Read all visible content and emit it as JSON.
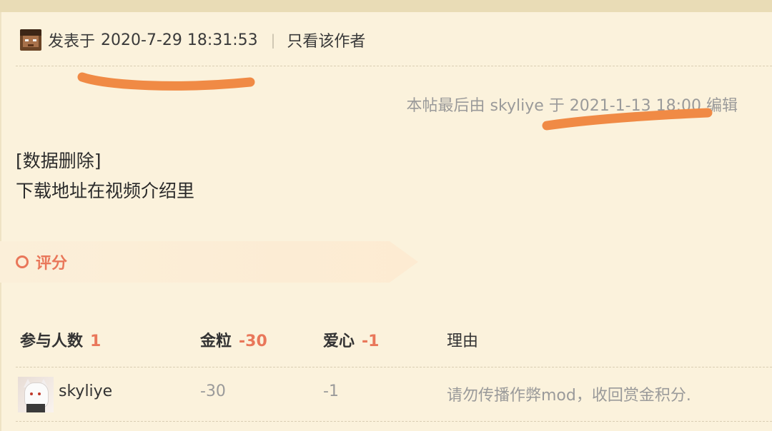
{
  "post": {
    "posted_prefix": "发表于",
    "posted_time": "2020-7-29 18:31:53",
    "separator": "|",
    "author_only": "只看该作者",
    "edit_note": "本帖最后由 skyliye 于 2021-1-13 18:00 编辑",
    "content_lines": [
      "[数据删除]",
      "下载地址在视频介绍里"
    ]
  },
  "rating": {
    "title": "评分",
    "headers": {
      "participants_label": "参与人数",
      "participants_count": "1",
      "gold_label": "金粒",
      "gold_total": "-30",
      "heart_label": "爱心",
      "heart_total": "-1",
      "reason_label": "理由"
    },
    "rows": [
      {
        "user": "skyliye",
        "gold": "-30",
        "heart": "-1",
        "reason": "请勿传播作弊mod，收回赏金积分."
      }
    ]
  },
  "colors": {
    "background": "#fbf2dc",
    "accent": "#e9775a",
    "scribble": "#f08a45",
    "muted_text": "#9a9a9a"
  },
  "icons": {
    "poster_avatar": "pixel-character-avatar",
    "rating_marker": "ring-icon"
  }
}
